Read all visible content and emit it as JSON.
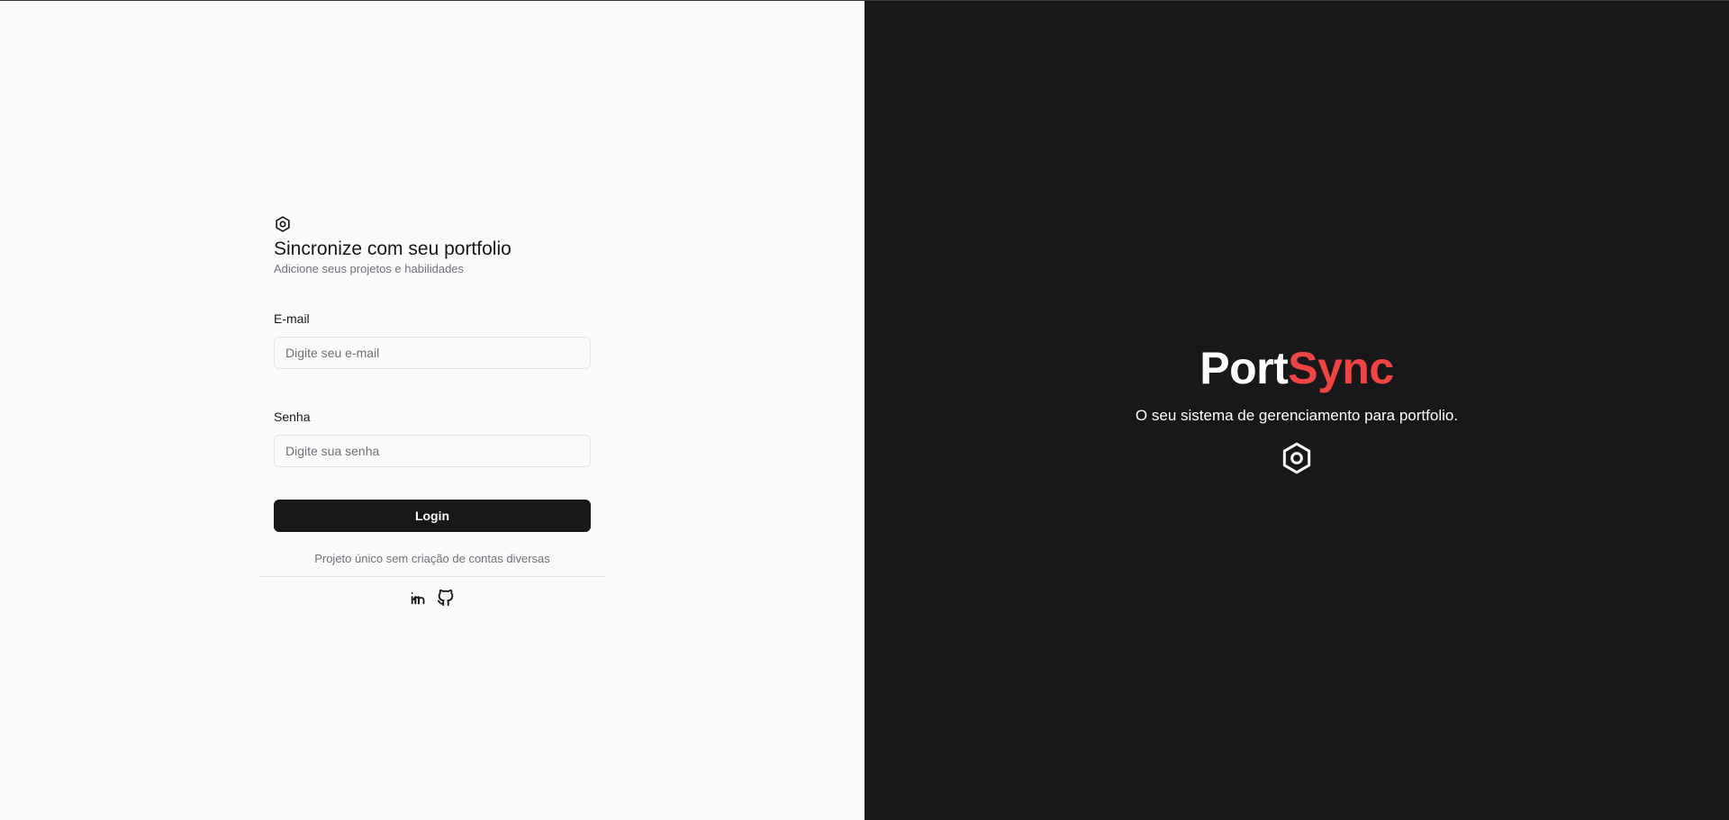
{
  "login": {
    "title": "Sincronize com seu portfolio",
    "subtitle": "Adicione seus projetos e habilidades",
    "email_label": "E-mail",
    "email_placeholder": "Digite seu e-mail",
    "email_value": "",
    "password_label": "Senha",
    "password_placeholder": "Digite sua senha",
    "password_value": "",
    "submit_label": "Login",
    "note": "Projeto único sem criação de contas diversas",
    "socials": [
      {
        "icon": "linkedin-icon"
      },
      {
        "icon": "github-icon"
      }
    ],
    "logo_icon": "hexagon-nut-icon"
  },
  "hero": {
    "brand_part1": "Port",
    "brand_part2": "Sync",
    "tagline": "O seu sistema de gerenciamento para portfolio.",
    "icon": "hexagon-nut-icon"
  },
  "colors": {
    "accent": "#ef4444",
    "dark": "#18181b",
    "light": "#fafafa",
    "muted": "#71717a"
  }
}
